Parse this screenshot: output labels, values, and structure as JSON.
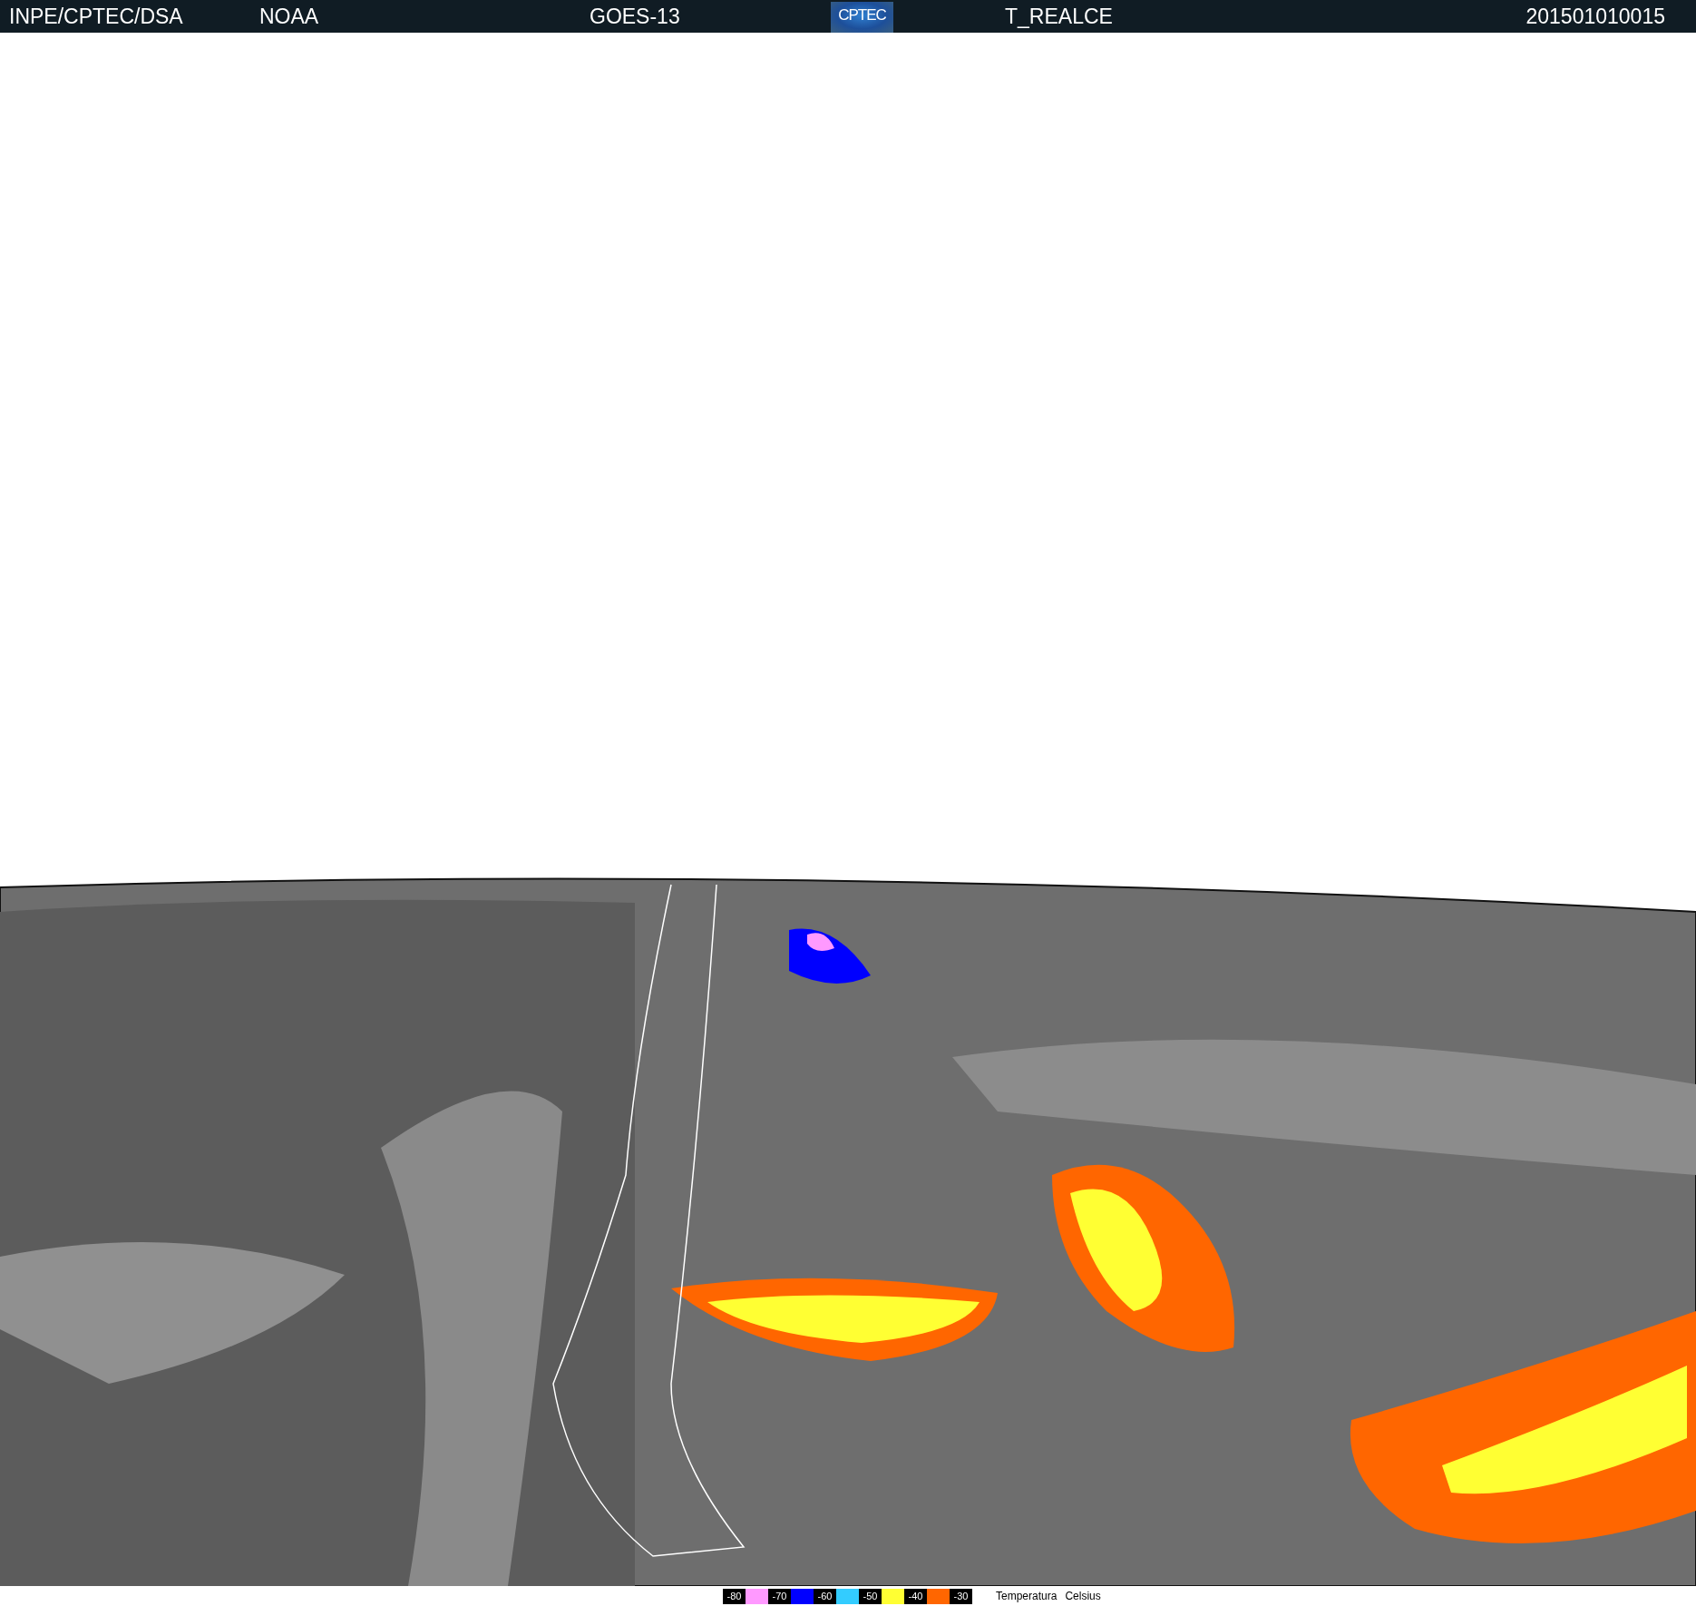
{
  "header": {
    "source": "INPE/CPTEC/DSA",
    "agency": "NOAA",
    "satellite": "GOES-13",
    "logo": "CPTEC",
    "product": "T_REALCE",
    "timestamp": "201501010015"
  },
  "legend": {
    "items": [
      {
        "kind": "label",
        "text": "-80"
      },
      {
        "kind": "swatch",
        "color": "#ff99ff"
      },
      {
        "kind": "label",
        "text": "-70"
      },
      {
        "kind": "swatch",
        "color": "#0000ff"
      },
      {
        "kind": "label",
        "text": "-60"
      },
      {
        "kind": "swatch",
        "color": "#33ccff"
      },
      {
        "kind": "label",
        "text": "-50"
      },
      {
        "kind": "swatch",
        "color": "#ffff33"
      },
      {
        "kind": "label",
        "text": "-40"
      },
      {
        "kind": "swatch",
        "color": "#ff6600"
      },
      {
        "kind": "label",
        "text": "-30"
      }
    ],
    "caption": [
      "Temperatura",
      "Celsius"
    ]
  }
}
